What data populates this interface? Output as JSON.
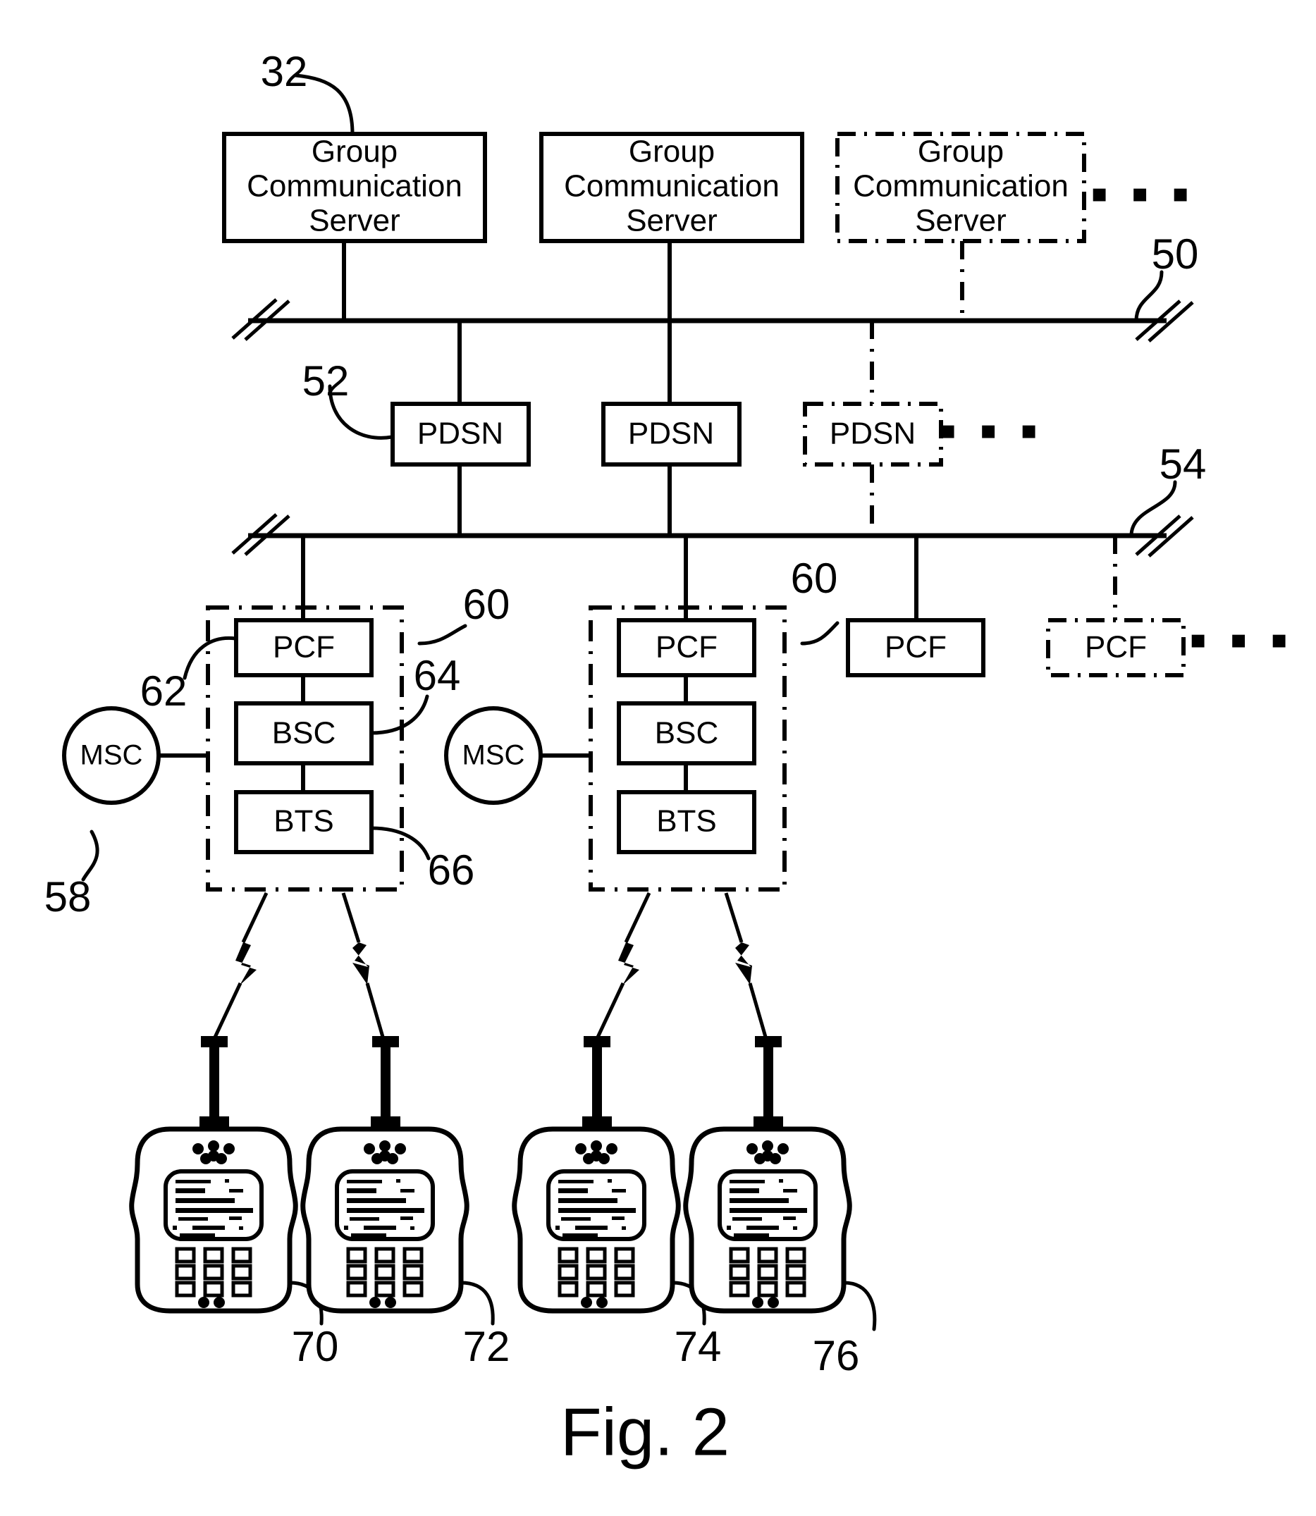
{
  "figure": {
    "caption": "Fig. 2",
    "title": "Group communication network architecture diagram"
  },
  "ellipsis": "▪ ▪ ▪",
  "servers": [
    {
      "id": "gcs-1",
      "line1": "Group",
      "line2": "Communication",
      "line3": "Server",
      "style": "solid"
    },
    {
      "id": "gcs-2",
      "line1": "Group",
      "line2": "Communication",
      "line3": "Server",
      "style": "solid"
    },
    {
      "id": "gcs-3",
      "line1": "Group",
      "line2": "Communication",
      "line3": "Server",
      "style": "phantom"
    }
  ],
  "pdsn_nodes": [
    {
      "id": "pdsn-1",
      "label": "PDSN",
      "style": "solid"
    },
    {
      "id": "pdsn-2",
      "label": "PDSN",
      "style": "solid"
    },
    {
      "id": "pdsn-3",
      "label": "PDSN",
      "style": "phantom"
    }
  ],
  "pcf_nodes": [
    {
      "id": "pcf-1",
      "label": "PCF",
      "style": "solid"
    },
    {
      "id": "pcf-2",
      "label": "PCF",
      "style": "solid"
    },
    {
      "id": "pcf-3",
      "label": "PCF",
      "style": "solid"
    },
    {
      "id": "pcf-4",
      "label": "PCF",
      "style": "phantom"
    }
  ],
  "bsc_nodes": [
    {
      "id": "bsc-1",
      "label": "BSC"
    },
    {
      "id": "bsc-2",
      "label": "BSC"
    }
  ],
  "bts_nodes": [
    {
      "id": "bts-1",
      "label": "BTS"
    },
    {
      "id": "bts-2",
      "label": "BTS"
    }
  ],
  "msc_nodes": [
    {
      "id": "msc-1",
      "label": "MSC"
    },
    {
      "id": "msc-2",
      "label": "MSC"
    }
  ],
  "buses": [
    {
      "id": "bus-upper",
      "ref": "50"
    },
    {
      "id": "bus-lower",
      "ref": "54"
    }
  ],
  "reference_numerals": [
    {
      "id": "ref-32",
      "value": "32",
      "points_to": "gcs-1"
    },
    {
      "id": "ref-50",
      "value": "50",
      "points_to": "bus-upper"
    },
    {
      "id": "ref-52",
      "value": "52",
      "points_to": "pdsn-1"
    },
    {
      "id": "ref-54",
      "value": "54",
      "points_to": "bus-lower"
    },
    {
      "id": "ref-58",
      "value": "58",
      "points_to": "msc-1"
    },
    {
      "id": "ref-60a",
      "value": "60",
      "points_to": "bss-group-1"
    },
    {
      "id": "ref-60b",
      "value": "60",
      "points_to": "bss-group-2"
    },
    {
      "id": "ref-62",
      "value": "62",
      "points_to": "pcf-1"
    },
    {
      "id": "ref-64",
      "value": "64",
      "points_to": "bsc-1"
    },
    {
      "id": "ref-66",
      "value": "66",
      "points_to": "bts-1"
    },
    {
      "id": "ref-70",
      "value": "70",
      "points_to": "handset-1"
    },
    {
      "id": "ref-72",
      "value": "72",
      "points_to": "handset-2"
    },
    {
      "id": "ref-74",
      "value": "74",
      "points_to": "handset-3"
    },
    {
      "id": "ref-76",
      "value": "76",
      "points_to": "handset-4"
    }
  ],
  "handsets": [
    {
      "id": "handset-1",
      "ref": "70"
    },
    {
      "id": "handset-2",
      "ref": "72"
    },
    {
      "id": "handset-3",
      "ref": "74"
    },
    {
      "id": "handset-4",
      "ref": "76"
    }
  ],
  "bss_groups": [
    {
      "id": "bss-group-1",
      "ref": "60",
      "members": [
        "PCF",
        "BSC",
        "BTS"
      ]
    },
    {
      "id": "bss-group-2",
      "ref": "60",
      "members": [
        "PCF",
        "BSC",
        "BTS"
      ]
    }
  ]
}
